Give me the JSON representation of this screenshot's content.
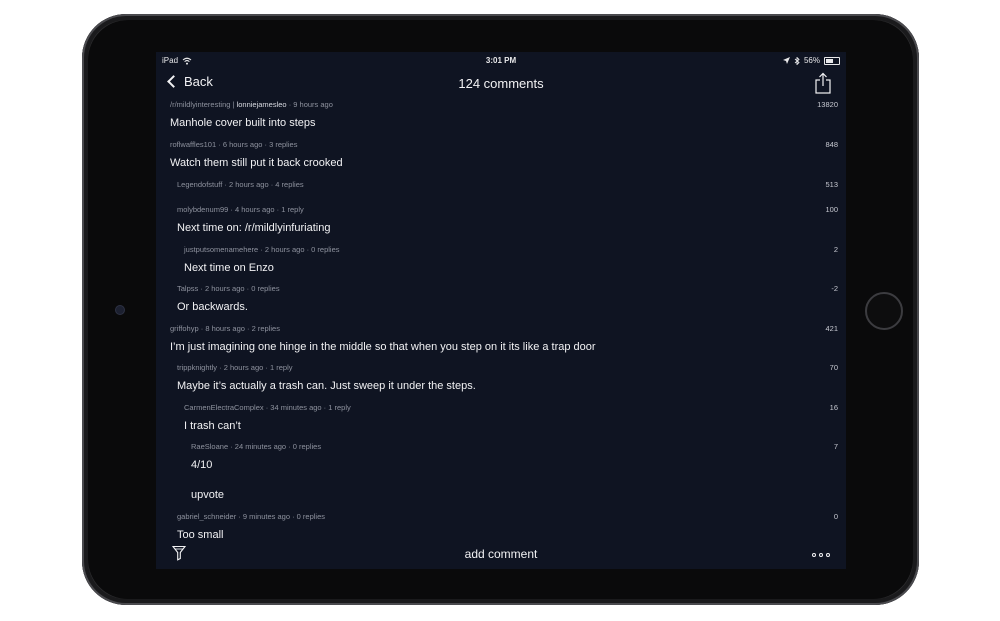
{
  "status_bar": {
    "carrier": "iPad",
    "time": "3:01 PM",
    "battery": "56%",
    "battery_level": 0.56
  },
  "nav": {
    "back_label": "Back",
    "title": "124 comments"
  },
  "post": {
    "subreddit": "/r/mildlyinteresting",
    "author": "lonniejamesleo",
    "time": "9 hours ago",
    "score": "13820",
    "title": "Manhole cover built into steps"
  },
  "comments": [
    {
      "author": "roflwaffles101",
      "meta": "6 hours ago · 3 replies",
      "score": "848",
      "body": "Watch them still put it back crooked",
      "depth": 0
    },
    {
      "author": "Legendofstuff",
      "meta": "2 hours ago · 4 replies",
      "score": "513",
      "body": "",
      "depth": 1
    },
    {
      "author": "molybdenum99",
      "meta": "4 hours ago · 1 reply",
      "score": "100",
      "body": "Next time on: /r/mildlyinfuriating",
      "depth": 1
    },
    {
      "author": "justputsomenamehere",
      "meta": "2 hours ago · 0 replies",
      "score": "2",
      "body": "Next time on Enzo",
      "depth": 2
    },
    {
      "author": "Talpss",
      "meta": "2 hours ago · 0 replies",
      "score": "-2",
      "body": "Or backwards.",
      "depth": 1
    },
    {
      "author": "griffohyp",
      "meta": "8 hours ago · 2 replies",
      "score": "421",
      "body": "I’m just imagining one hinge in the middle so that when you step on it its like a trap door",
      "depth": 0
    },
    {
      "author": "trippknightly",
      "meta": "2 hours ago · 1 reply",
      "score": "70",
      "body": "Maybe it’s actually a trash can.  Just sweep it under the steps.",
      "depth": 1
    },
    {
      "author": "CarmenElectraComplex",
      "meta": "34 minutes ago · 1 reply",
      "score": "16",
      "body": "I trash can’t",
      "depth": 2
    },
    {
      "author": "RaeSloane",
      "meta": "24 minutes ago · 0 replies",
      "score": "7",
      "body": "4/10",
      "body2": "upvote",
      "depth": 3
    },
    {
      "author": "gabriel_schneider",
      "meta": "9 minutes ago · 0 replies",
      "score": "0",
      "body": "Too small",
      "depth": 1
    }
  ],
  "toolbar": {
    "add_comment_label": "add comment"
  },
  "icons": {
    "wifi": "wifi-icon",
    "location": "location-arrow-icon",
    "bluetooth": "bluetooth-icon",
    "battery": "battery-icon",
    "back": "chevron-left-icon",
    "share": "share-icon",
    "filter": "filter-icon",
    "more": "more-dots-icon"
  },
  "colors": {
    "screen_bg": "#0f1422",
    "text": "#f2f2f4",
    "meta_text": "#8e929e"
  }
}
